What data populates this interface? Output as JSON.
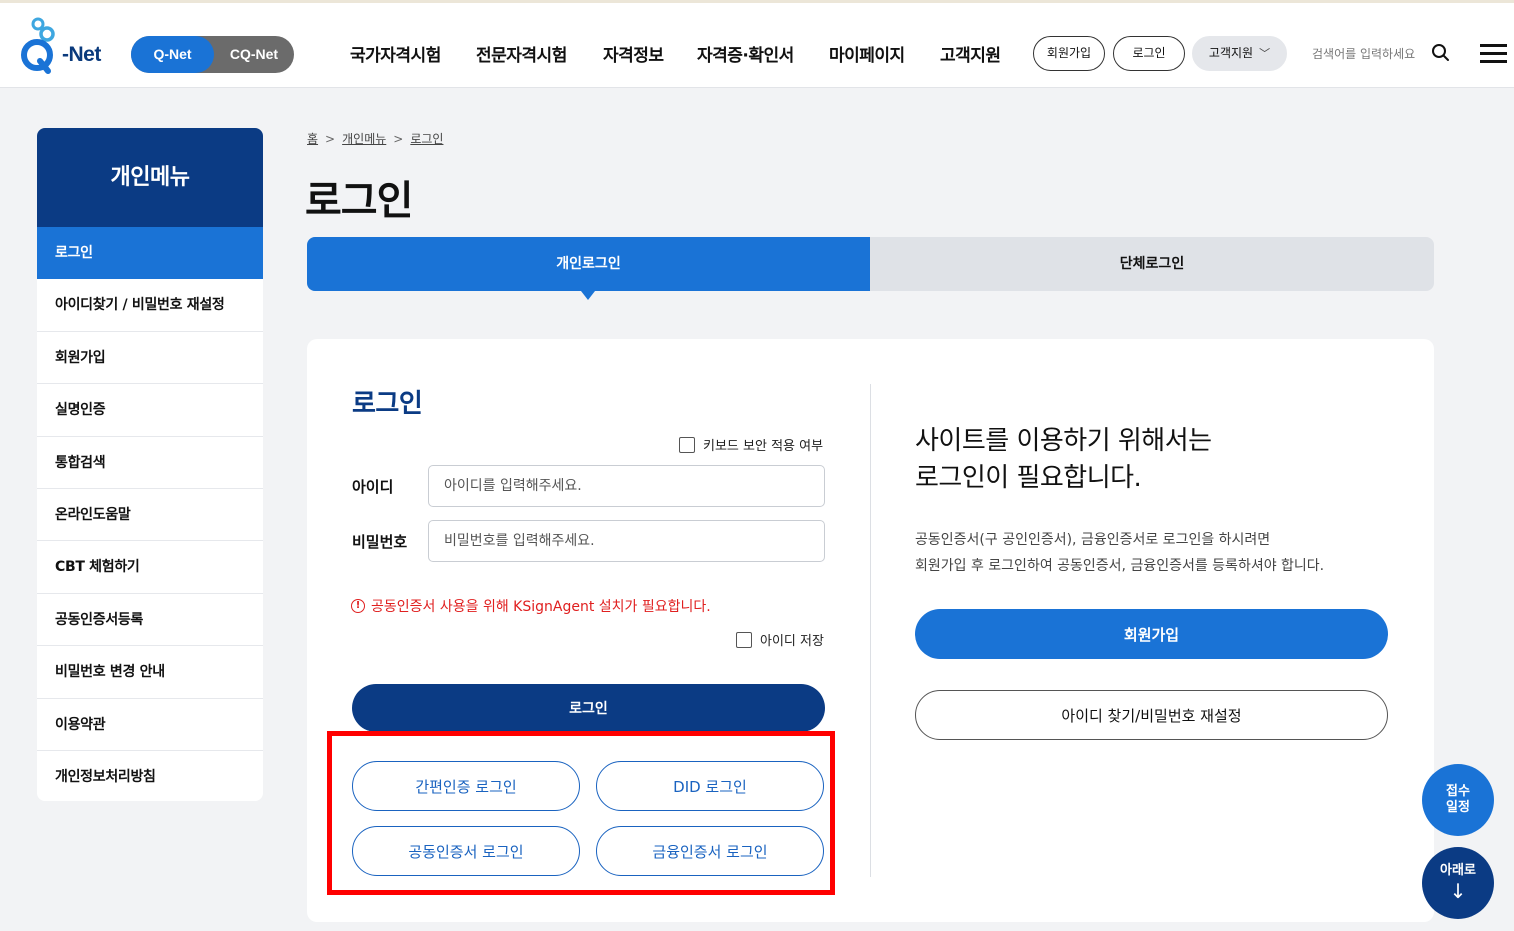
{
  "header": {
    "logo_text": "-Net",
    "switch": {
      "active": "Q-Net",
      "inactive": "CQ-Net"
    },
    "gnb": [
      "국가자격시험",
      "전문자격시험",
      "자격정보",
      "자격증·확인서",
      "마이페이지",
      "고객지원"
    ],
    "pills": {
      "join": "회원가입",
      "login": "로그인",
      "support": "고객지원"
    },
    "search_placeholder": "검색어를 입력하세요"
  },
  "sidebar": {
    "title": "개인메뉴",
    "items": [
      {
        "label": "로그인",
        "active": true
      },
      {
        "label": "아이디찾기 / 비밀번호 재설정"
      },
      {
        "label": "회원가입"
      },
      {
        "label": "실명인증"
      },
      {
        "label": "통합검색"
      },
      {
        "label": "온라인도움말"
      },
      {
        "label": "CBT 체험하기"
      },
      {
        "label": "공동인증서등록"
      },
      {
        "label": "비밀번호 변경 안내"
      },
      {
        "label": "이용약관"
      },
      {
        "label": "개인정보처리방침"
      }
    ]
  },
  "breadcrumb": {
    "home": "홈",
    "level1": "개인메뉴",
    "level2": "로그인"
  },
  "page_title": "로그인",
  "tabs": {
    "personal": "개인로그인",
    "group": "단체로그인"
  },
  "login_form": {
    "heading": "로그인",
    "keyboard_security": "키보드 보안 적용 여부",
    "id_label": "아이디",
    "id_placeholder": "아이디를 입력해주세요.",
    "pw_label": "비밀번호",
    "pw_placeholder": "비밀번호를 입력해주세요.",
    "warning": "공동인증서 사용을 위해 KSignAgent 설치가 필요합니다.",
    "save_id": "아이디 저장",
    "login_button": "로그인",
    "alt_logins": {
      "simple_auth": "간편인증 로그인",
      "did": "DID 로그인",
      "joint_cert": "공동인증서 로그인",
      "financial_cert": "금융인증서 로그인"
    }
  },
  "right_panel": {
    "heading_line1": "사이트를 이용하기 위해서는",
    "heading_line2": "로그인이 필요합니다.",
    "desc_line1": "공동인증서(구 공인인증서), 금융인증서로 로그인을 하시려면",
    "desc_line2": "회원가입 후 로그인하여 공동인증서, 금융인증서를 등록하셔야 합니다.",
    "join_button": "회원가입",
    "find_button": "아이디 찾기/비밀번호 재설정"
  },
  "floating": {
    "schedule_line1": "접수",
    "schedule_line2": "일정",
    "down_label": "아래로",
    "down_arrow": "↓"
  },
  "colors": {
    "primary_blue": "#1a73d6",
    "navy": "#0b3b84",
    "highlight_red": "#ff0000",
    "warning_red": "#e02020"
  }
}
